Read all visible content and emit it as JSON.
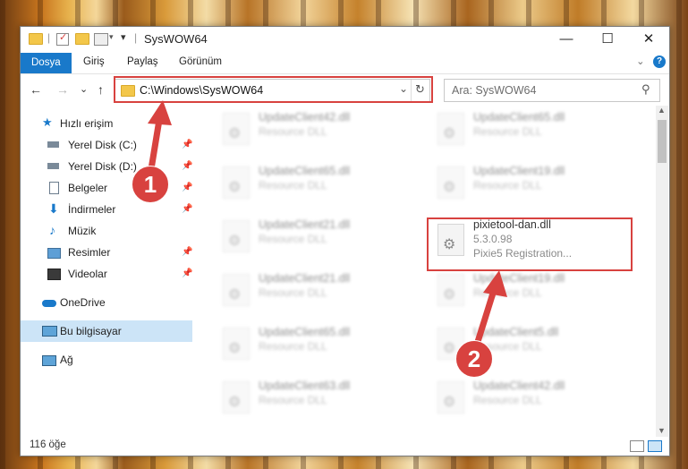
{
  "window": {
    "title": "SysWOW64",
    "minimize_glyph": "—",
    "maximize_glyph": "☐",
    "close_glyph": "✕"
  },
  "ribbon": {
    "tabs": [
      "Dosya",
      "Giriş",
      "Paylaş",
      "Görünüm"
    ],
    "expand_glyph": "⌄",
    "help_glyph": "?"
  },
  "navigation": {
    "back_glyph": "←",
    "forward_glyph": "→",
    "recent_glyph": "⌄",
    "up_glyph": "↑",
    "address": "C:\\Windows\\SysWOW64",
    "address_dropdown_glyph": "⌄",
    "refresh_glyph": "↻",
    "search_placeholder": "Ara: SysWOW64",
    "search_glyph": "⚲"
  },
  "sidebar": {
    "items": [
      {
        "label": "Hızlı erişim",
        "icon": "star-icon",
        "pinned": false
      },
      {
        "label": "Yerel Disk (C:)",
        "icon": "drive-icon",
        "pinned": true
      },
      {
        "label": "Yerel Disk (D:)",
        "icon": "drive-icon",
        "pinned": true
      },
      {
        "label": "Belgeler",
        "icon": "documents-icon",
        "pinned": true
      },
      {
        "label": "İndirmeler",
        "icon": "downloads-icon",
        "pinned": true
      },
      {
        "label": "Müzik",
        "icon": "music-icon",
        "pinned": true
      },
      {
        "label": "Resimler",
        "icon": "pictures-icon",
        "pinned": true
      },
      {
        "label": "Videolar",
        "icon": "videos-icon",
        "pinned": true
      },
      {
        "label": "OneDrive",
        "icon": "cloud-icon",
        "pinned": false
      },
      {
        "label": "Bu bilgisayar",
        "icon": "computer-icon",
        "pinned": false
      },
      {
        "label": "Ağ",
        "icon": "network-icon",
        "pinned": false
      }
    ],
    "pin_glyph": "📌"
  },
  "files": [
    {
      "name": "UpdateClient42.dll",
      "desc": "Resource DLL"
    },
    {
      "name": "UpdateClient65.dll",
      "desc": "Resource DLL"
    },
    {
      "name": "UpdateClient65.dll",
      "desc": "Resource DLL"
    },
    {
      "name": "UpdateClient19.dll",
      "desc": "Resource DLL"
    },
    {
      "name": "UpdateClient21.dll",
      "desc": "Resource DLL"
    },
    {
      "name": "pixietool-dan.dll",
      "version": "5.3.0.98",
      "desc": "Pixie5 Registration..."
    },
    {
      "name": "UpdateClient21.dll",
      "desc": "Resource DLL"
    },
    {
      "name": "UpdateClient19.dll",
      "desc": "Resource DLL"
    },
    {
      "name": "UpdateClient65.dll",
      "desc": "Resource DLL"
    },
    {
      "name": "UpdateClient5.dll",
      "desc": "Resource DLL"
    },
    {
      "name": "UpdateClient63.dll",
      "desc": "Resource DLL"
    },
    {
      "name": "UpdateClient42.dll",
      "desc": "Resource DLL"
    }
  ],
  "status": {
    "count": "116 öğe"
  },
  "annotations": {
    "badge1": "1",
    "badge2": "2",
    "color": "#d8423f"
  },
  "colors": {
    "accent": "#1979ca",
    "selection": "#cce4f7"
  }
}
